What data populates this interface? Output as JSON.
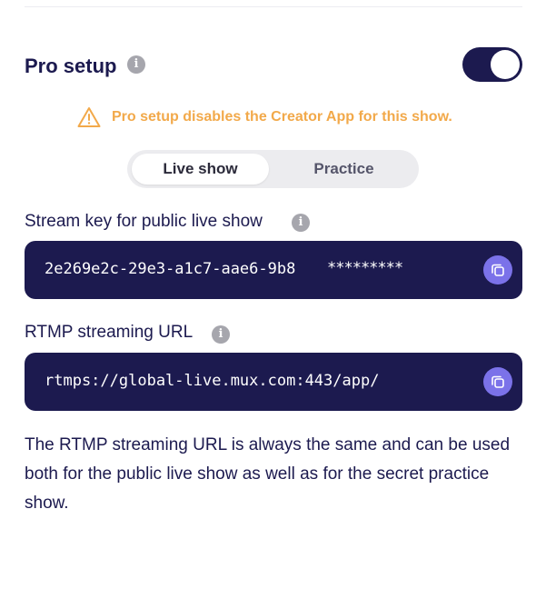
{
  "pro_setup": {
    "title": "Pro setup",
    "info_icon": "i",
    "toggle_on": true,
    "warning": "Pro setup disables the Creator App for this show."
  },
  "segmented": {
    "options": [
      {
        "label": "Live show",
        "selected": true
      },
      {
        "label": "Practice",
        "selected": false
      }
    ]
  },
  "stream_key": {
    "label": "Stream key for public live show",
    "info_icon": "i",
    "value_visible": "2e269e2c-29e3-a1c7-aae6-9b8",
    "value_masked": "*********"
  },
  "rtmp": {
    "label": "RTMP streaming URL",
    "info_icon": "i",
    "value": "rtmps://global-live.mux.com:443/app/"
  },
  "helper_text": "The RTMP streaming URL is always the same and can be used both for the public live show as well as for the secret practice show.",
  "colors": {
    "primary": "#1c1a4f",
    "warning": "#f2a94a",
    "copy_button": "#7b72e9",
    "segment_bg": "#ececef"
  }
}
